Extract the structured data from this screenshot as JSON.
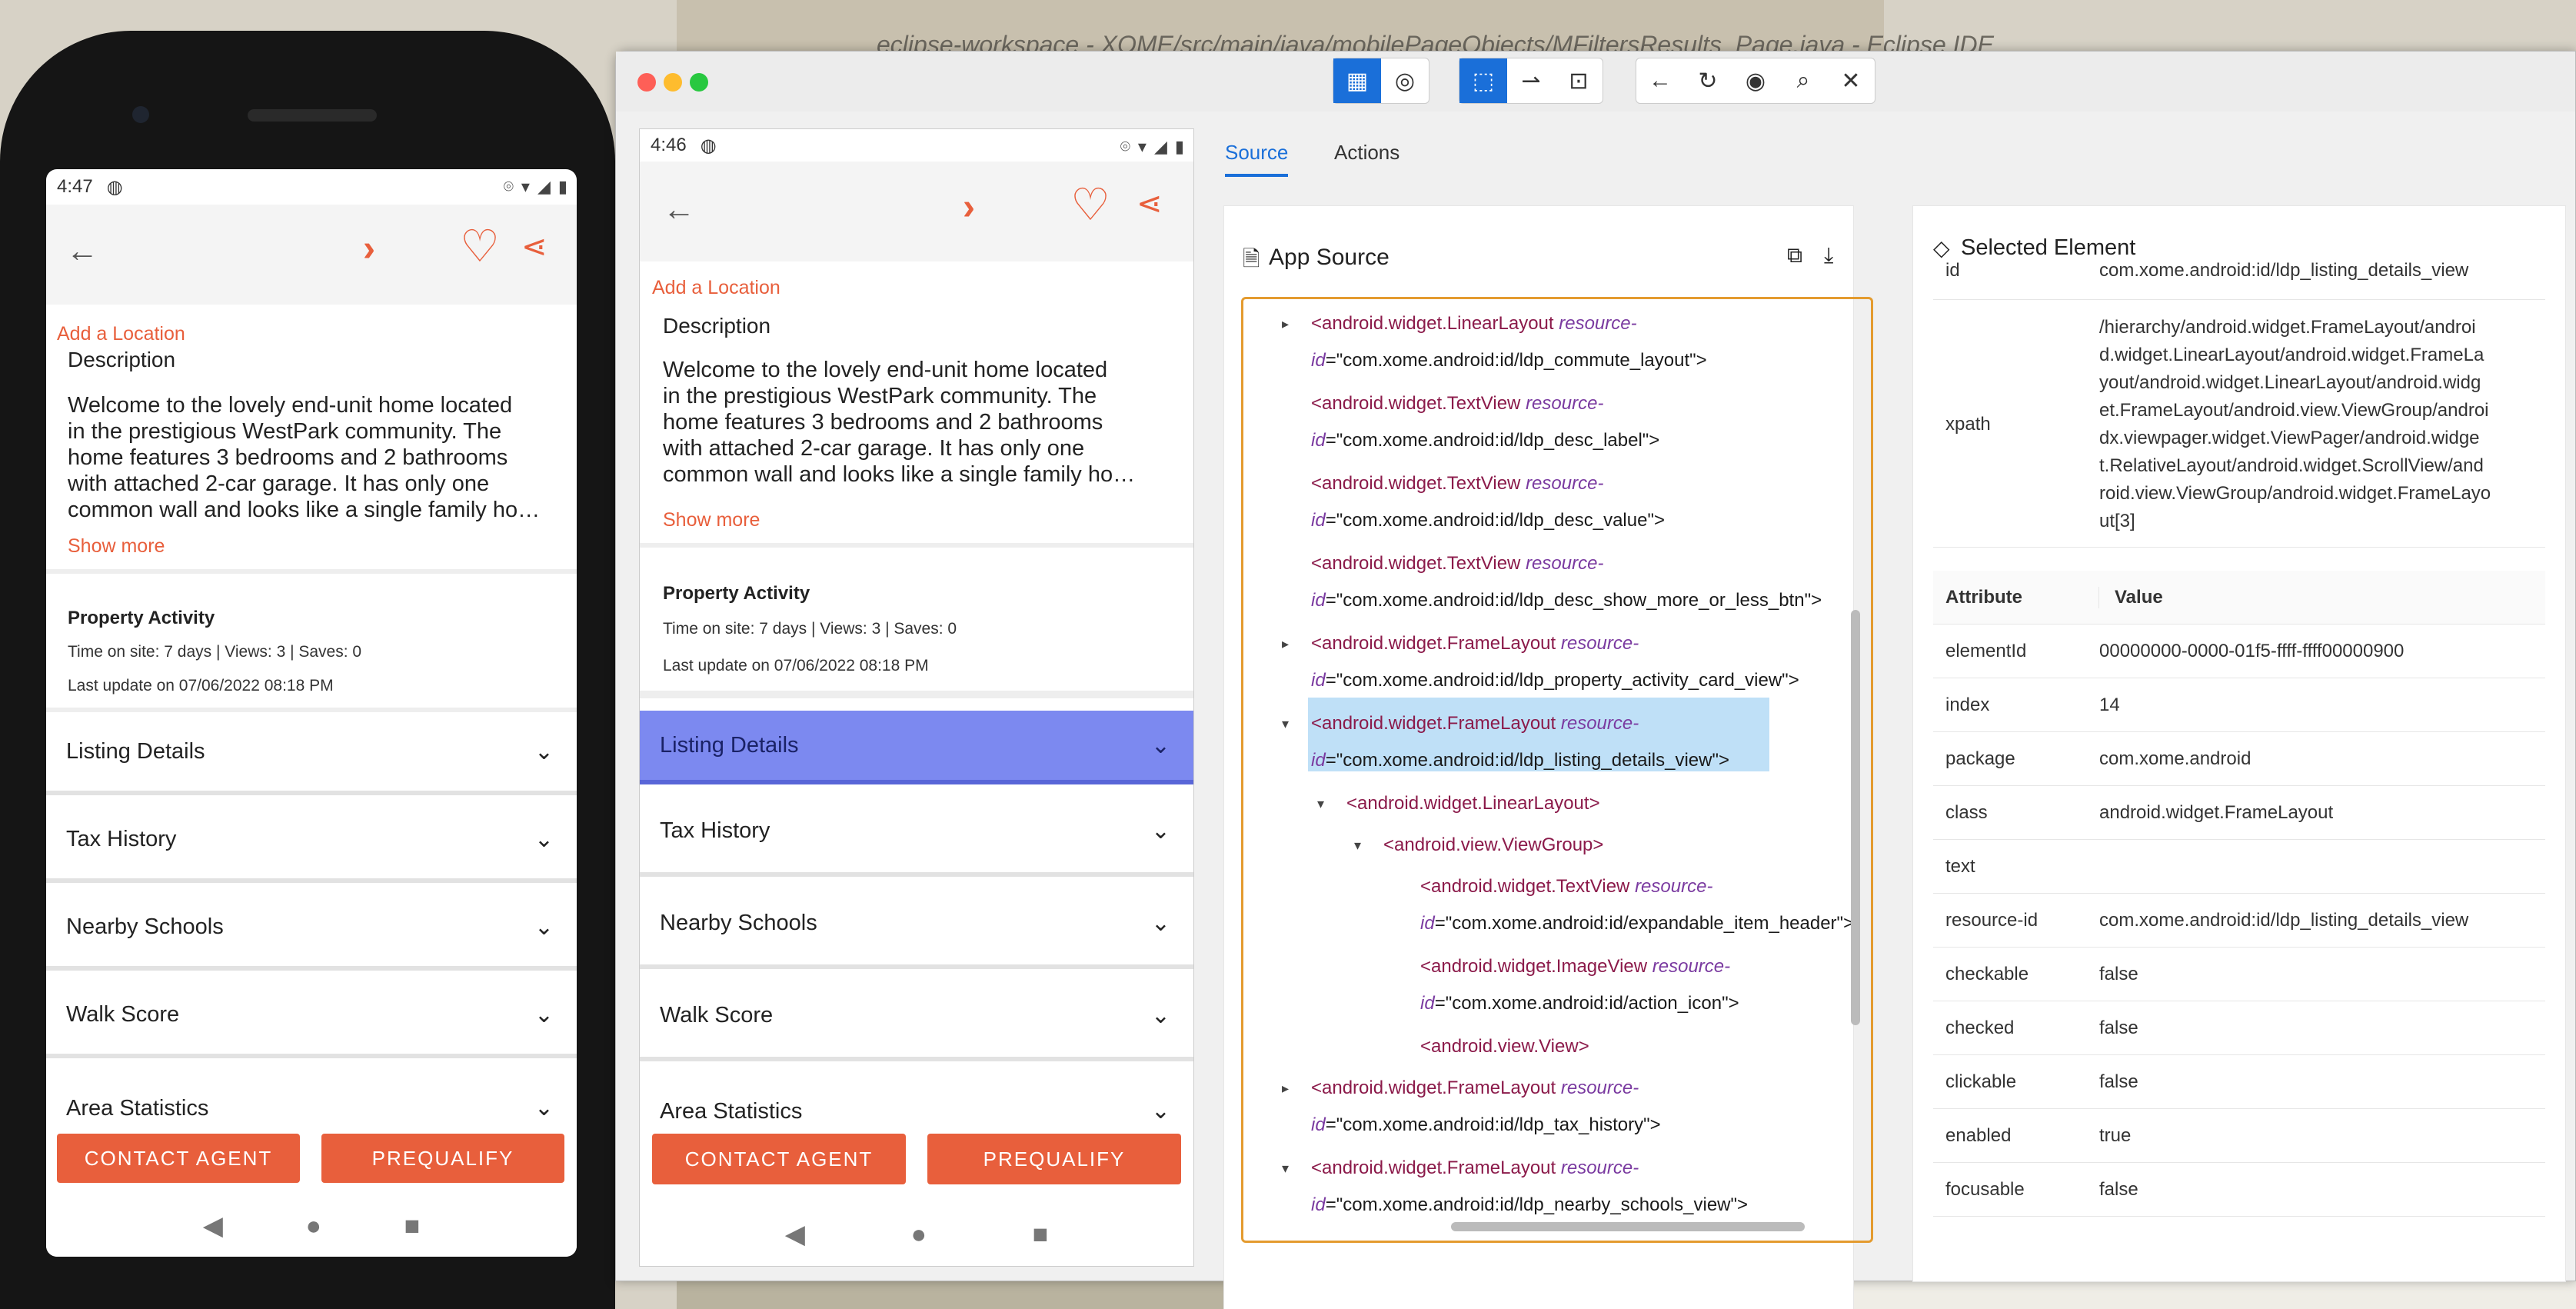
{
  "background": {
    "path_text": "eclipse-workspace - XOME/src/main/java/mobilePageObjects/MFiltersResults_Page.java - Eclipse IDE"
  },
  "phone": {
    "status_time": "4:47",
    "add_location": "Add a Location",
    "description_title": "Description",
    "description_lines": [
      "Welcome to the lovely end-unit home located",
      "in the prestigious WestPark community. The",
      "home features 3 bedrooms and 2 bathrooms",
      "with attached 2-car garage. It has only one",
      "common wall and looks like a single family ho…"
    ],
    "show_more": "Show more",
    "activity_title": "Property Activity",
    "activity_stats": "Time on site: 7 days | Views: 3  | Saves: 0",
    "activity_update": "Last update on 07/06/2022 08:18 PM",
    "sections": [
      "Listing Details",
      "Tax History",
      "Nearby Schools",
      "Walk Score",
      "Area Statistics"
    ],
    "contact_btn": "CONTACT AGENT",
    "prequalify_btn": "PREQUALIFY"
  },
  "inspector": {
    "device": {
      "status_time": "4:46",
      "add_location": "Add a Location",
      "description_title": "Description",
      "description_lines": [
        "Welcome to the lovely end-unit home located",
        "in the prestigious WestPark community. The",
        "home features 3 bedrooms and 2 bathrooms",
        "with attached 2-car garage. It has only one",
        "common wall and looks like a single family ho…"
      ],
      "show_more": "Show more",
      "activity_title": "Property Activity",
      "activity_stats": "Time on site: 7 days | Views: 3  | Saves: 0",
      "activity_update": "Last update on 07/06/2022 08:18 PM",
      "sections": [
        "Listing Details",
        "Tax History",
        "Nearby Schools",
        "Walk Score",
        "Area Statistics"
      ],
      "contact_btn": "CONTACT AGENT",
      "prequalify_btn": "PREQUALIFY"
    },
    "tabs": [
      "Source",
      "Actions"
    ],
    "source_title": "App Source",
    "source_lines": [
      {
        "tag": "<android.widget.LinearLayout",
        "attr": "resource-",
        "cont": "id",
        "val": "=\"com.xome.android:id/ldp_commute_layout\">"
      },
      {
        "tag": "<android.widget.TextView",
        "attr": "resource-",
        "cont": "id",
        "val": "=\"com.xome.android:id/ldp_desc_label\">"
      },
      {
        "tag": "<android.widget.TextView",
        "attr": "resource-",
        "cont": "id",
        "val": "=\"com.xome.android:id/ldp_desc_value\">"
      },
      {
        "tag": "<android.widget.TextView",
        "attr": "resource-",
        "cont": "id",
        "val": "=\"com.xome.android:id/ldp_desc_show_more_or_less_btn\">"
      },
      {
        "tag": "<android.widget.FrameLayout",
        "attr": "resource-",
        "cont": "id",
        "val": "=\"com.xome.android:id/ldp_property_activity_card_view\">"
      },
      {
        "tag": "<android.widget.FrameLayout",
        "attr": "resource-",
        "cont": "id",
        "val": "=\"com.xome.android:id/ldp_listing_details_view\">"
      },
      {
        "tag": "<android.widget.LinearLayout>",
        "attr": "",
        "cont": "",
        "val": ""
      },
      {
        "tag": "<android.view.ViewGroup>",
        "attr": "",
        "cont": "",
        "val": ""
      },
      {
        "tag": "<android.widget.TextView",
        "attr": "resource-",
        "cont": "id",
        "val": "=\"com.xome.android:id/expandable_item_header\">"
      },
      {
        "tag": "<android.widget.ImageView",
        "attr": "resource-",
        "cont": "id",
        "val": "=\"com.xome.android:id/action_icon\">"
      },
      {
        "tag": "<android.view.View>",
        "attr": "",
        "cont": "",
        "val": ""
      },
      {
        "tag": "<android.widget.FrameLayout",
        "attr": "resource-",
        "cont": "id",
        "val": "=\"com.xome.android:id/ldp_tax_history\">"
      },
      {
        "tag": "<android.widget.FrameLayout",
        "attr": "resource-",
        "cont": "id",
        "val": "=\"com.xome.android:id/ldp_nearby_schools_view\">"
      }
    ],
    "selected_title": "Selected Element",
    "top_id_key": "id",
    "top_id_val": "com.xome.android:id/ldp_listing_details_view",
    "xpath_key": "xpath",
    "xpath_lines": [
      "/hierarchy/android.widget.FrameLayout/androi",
      "d.widget.LinearLayout/android.widget.FrameLa",
      "yout/android.widget.LinearLayout/android.widg",
      "et.FrameLayout/android.view.ViewGroup/androi",
      "dx.viewpager.widget.ViewPager/android.widge",
      "t.RelativeLayout/android.widget.ScrollView/and",
      "roid.view.ViewGroup/android.widget.FrameLayo",
      "ut[3]"
    ],
    "attr_header": [
      "Attribute",
      "Value"
    ],
    "attributes": [
      {
        "k": "elementId",
        "v": "00000000-0000-01f5-ffff-ffff00000900"
      },
      {
        "k": "index",
        "v": "14"
      },
      {
        "k": "package",
        "v": "com.xome.android"
      },
      {
        "k": "class",
        "v": "android.widget.FrameLayout"
      },
      {
        "k": "text",
        "v": ""
      },
      {
        "k": "resource-id",
        "v": "com.xome.android:id/ldp_listing_details_view"
      },
      {
        "k": "checkable",
        "v": "false"
      },
      {
        "k": "checked",
        "v": "false"
      },
      {
        "k": "clickable",
        "v": "false"
      },
      {
        "k": "enabled",
        "v": "true"
      },
      {
        "k": "focusable",
        "v": "false"
      }
    ]
  }
}
